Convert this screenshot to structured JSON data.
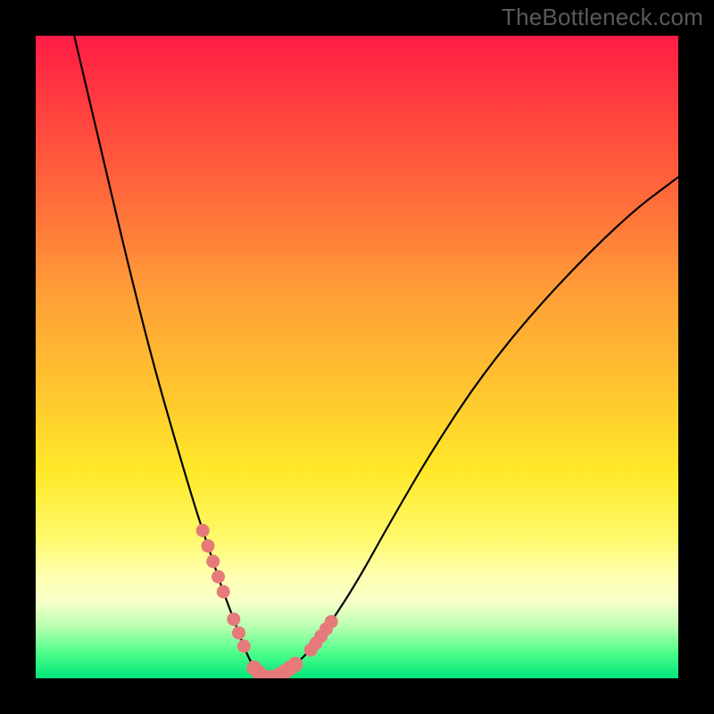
{
  "watermark": "TheBottleneck.com",
  "colors": {
    "frame": "#000000",
    "gradient_stops": [
      "#ff1c45",
      "#ff3b3f",
      "#ff6a3a",
      "#ff9e37",
      "#ffc52f",
      "#ffe92a",
      "#fff96a",
      "#ffffb0",
      "#f7ffc8",
      "#b8ffb0",
      "#4fff8a",
      "#00e47a"
    ],
    "curve": "#000000",
    "beads": "#e67a7a"
  },
  "chart_data": {
    "type": "line",
    "title": "",
    "xlabel": "",
    "ylabel": "",
    "xlim": [
      0,
      100
    ],
    "ylim": [
      0,
      100
    ],
    "series": [
      {
        "name": "bottleneck-curve",
        "x": [
          6,
          10,
          14,
          18,
          22,
          25,
          27,
          29,
          30.5,
          32,
          33,
          34,
          35,
          36,
          37,
          38,
          40,
          43,
          46,
          50,
          55,
          62,
          70,
          80,
          92,
          100
        ],
        "y": [
          100,
          83,
          66,
          50,
          36,
          26,
          20,
          14,
          10,
          6,
          3.5,
          1.6,
          0.6,
          0.1,
          0.1,
          0.55,
          1.8,
          4.6,
          8.8,
          15,
          24,
          36,
          48,
          60,
          72,
          78
        ]
      }
    ],
    "beads_region_x": [
      26,
      46
    ],
    "annotations": []
  }
}
